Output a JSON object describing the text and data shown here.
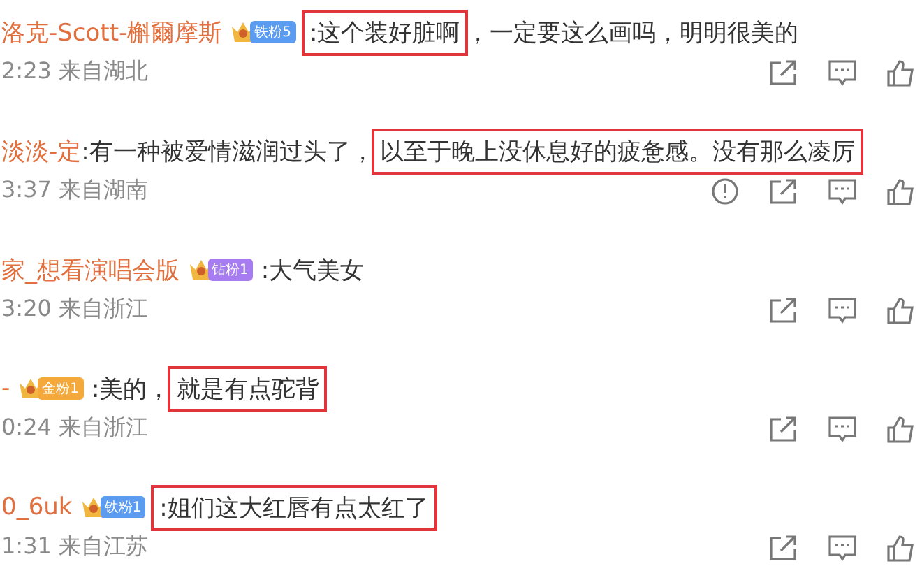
{
  "comments": [
    {
      "author": "洛克-Scott-槲爾摩斯",
      "badge": {
        "label": "铁粉5",
        "color": "#5b9cf0"
      },
      "segments": [
        {
          "text": ":这个装好脏啊",
          "boxed": true
        },
        {
          "text": "，一定要这么画吗，明明很美的",
          "boxed": false
        }
      ],
      "time": "2:23",
      "location": "来自湖北",
      "actions": [
        {
          "kind": "share"
        },
        {
          "kind": "comment"
        },
        {
          "kind": "like"
        }
      ]
    },
    {
      "author": "淡淡-定",
      "segments": [
        {
          "text": ":有一种被爱情滋润过头了，",
          "boxed": false
        },
        {
          "text": "以至于晚上没休息好的疲惫感。没有那么凌厉",
          "boxed": true
        }
      ],
      "time": "3:37",
      "location": "来自湖南",
      "actions": [
        {
          "kind": "report"
        },
        {
          "kind": "share"
        },
        {
          "kind": "comment"
        },
        {
          "kind": "like"
        }
      ]
    },
    {
      "author": "家_想看演唱会版",
      "badge": {
        "label": "钻粉1",
        "color": "#a67cf0"
      },
      "segments": [
        {
          "text": ":大气美女",
          "boxed": false
        }
      ],
      "time": "3:20",
      "location": "来自浙江",
      "actions": [
        {
          "kind": "share"
        },
        {
          "kind": "comment"
        },
        {
          "kind": "like"
        }
      ]
    },
    {
      "author": "-",
      "badge": {
        "label": "金粉1",
        "color": "#f5a93a"
      },
      "segments": [
        {
          "text": ":美的，",
          "boxed": false
        },
        {
          "text": "就是有点驼背",
          "boxed": true
        }
      ],
      "time": "0:24",
      "location": "来自浙江",
      "actions": [
        {
          "kind": "share"
        },
        {
          "kind": "comment"
        },
        {
          "kind": "like"
        }
      ]
    },
    {
      "author": "0_6uk",
      "badge": {
        "label": "铁粉1",
        "color": "#5b9cf0"
      },
      "segments": [
        {
          "text": ":姐们这大红唇有点太红了",
          "boxed": true
        }
      ],
      "time": "1:31",
      "location": "来自江苏",
      "actions": [
        {
          "kind": "share"
        },
        {
          "kind": "comment"
        },
        {
          "kind": "like"
        }
      ]
    }
  ]
}
